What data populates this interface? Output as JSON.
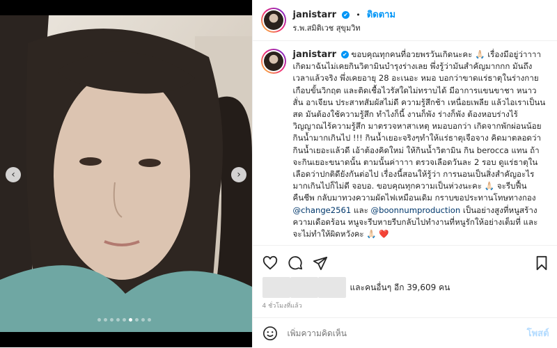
{
  "post": {
    "username": "janistarr",
    "verified_mark": "✔",
    "separator": "•",
    "follow_label": "ติดตาม",
    "location": "ร.พ.สมิติเวช สุขุมวิท",
    "caption": {
      "username": "janistarr",
      "text_1": "ขอบคุณทุกคนที่อวยพรวันเกิดนะคะ 🙏🏻 เรื่องมีอยู่ว่าาาา เกิดมาฉันไม่เคยกินวิตามินบำรุงร่างเลย พึ่งรู้ว่ามันสำคัญมากกก มันถึงเวลาแล้วจริง พึ่งเคยอายุ 28 อะเนอะ หมอ บอกว่าขาดแร่ธาตุในร่างกายเกือบขั้นวิกฤต และติดเชื้อไวรัสใดไม่ทราบได้ มีอาการแขนขาชา หนาวสั่น อาเจียน ประสาทสัมผัสไม่ดี ความรู้สึกช้า เหนื่อยเพลีย แล้วไอเราเป็นนสด มันต้องใช้ความรู้สึก ทำไงก็นี้ งานก็พัง ร่างก็พัง ต้องหอบร่างไร้วิญญาณไร้ความรู้สึก มาตรวจหาสาเหตุ หมอบอกว่า เกิดจากพักผ่อนน้อย กินน้ำมากเกินไป !!! กินน้ำเยอะจริงๆทำให้แร่ธาตุเจือจาง คิดมาตลอดว่ากินน้ำเยอะแล้วดี เอ้าต้องคิดใหม่ ให้กินน้ำวิตามิน กิน berocca แทน ถ้าจะกินเยอะขนาดนั้น ตามนั้นค่าาาา ตรวจเลือดวันละ 2 รอบ ดูแร่ธาตุในเลือดว่าปกติดียังกันต่อไป เรื่องนี้สอนให้รู้ว่า การนอนเป็นสิ่งสำคัญอะไรมากเกินไปก็ไม่ดี จอบอ. ขอบคุณทุกความเป็นห่วงนะคะ 🙏🏻 จะรีบฟื้นคืนชีพ กลับมาทวงความผัดไฟเหมือนเดิม กราบขอประทานโทษทางกอง",
      "mention_1": "@change2561",
      "and": " และ ",
      "mention_2": "@boonnumproduction",
      "text_2": " เป็นอย่างสูงที่หนูสร้างความเดือดร้อน หนูจะรีบหายรีบกลับไปทำงานที่หนูรักให้อย่างเต็มที่ และจะไม่ทำให้ผิดหวังคะ 🙏🏻 ❤️"
    },
    "likes_text": "และคนอื่นๆ อีก 39,609 คน",
    "time_ago": "4 ชั่วโมงที่แล้ว",
    "comment_placeholder": "เพิ่มความคิดเห็น",
    "post_label": "โพสต์",
    "carousel": {
      "count": 9,
      "active_index": 5
    }
  },
  "icons": {
    "like": "heart-icon",
    "comment": "comment-icon",
    "share": "send-icon",
    "save": "bookmark-icon",
    "emoji": "emoji-icon",
    "prev": "chevron-left-icon",
    "next": "chevron-right-icon"
  },
  "colors": {
    "accent": "#0095f6",
    "mention": "#00376b",
    "muted": "#8e8e8e",
    "post_disabled": "#b3dbff"
  }
}
